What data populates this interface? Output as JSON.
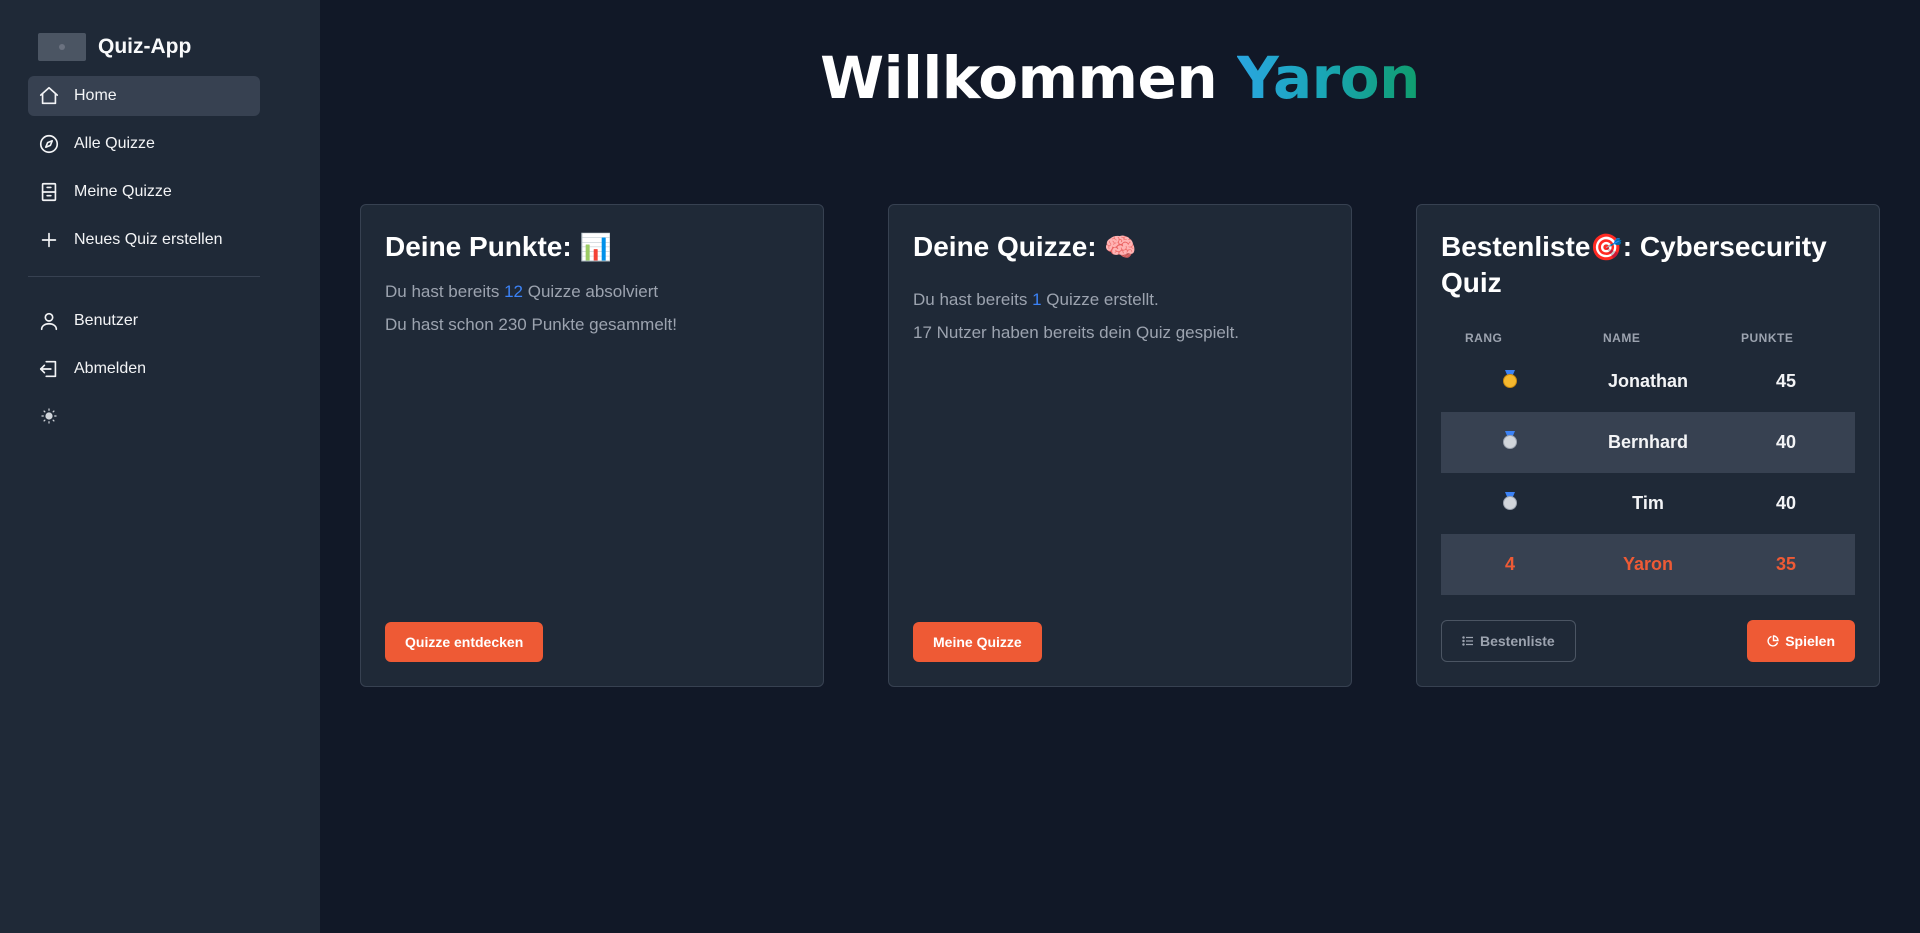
{
  "app": {
    "name": "Quiz-App"
  },
  "sidebar": {
    "items": [
      {
        "label": "Home",
        "icon": "home-icon",
        "active": true
      },
      {
        "label": "Alle Quizze",
        "icon": "compass-icon"
      },
      {
        "label": "Meine Quizze",
        "icon": "archive-icon"
      },
      {
        "label": "Neues Quiz erstellen",
        "icon": "plus-icon"
      }
    ],
    "secondary": [
      {
        "label": "Benutzer",
        "icon": "user-icon"
      },
      {
        "label": "Abmelden",
        "icon": "logout-icon"
      }
    ],
    "theme_icon": "sun-icon"
  },
  "header": {
    "greeting": "Willkommen",
    "username": "Yaron"
  },
  "points_card": {
    "title": "Deine Punkte:",
    "emoji": "📊",
    "line1_pre": "Du hast bereits",
    "line1_count": "12",
    "line1_post": "Quizze absolviert",
    "line2": "Du hast schon 230 Punkte gesammelt!",
    "button": "Quizze entdecken"
  },
  "quizzes_card": {
    "title": "Deine Quizze:",
    "emoji": "🧠",
    "line1_pre": "Du hast bereits",
    "line1_count": "1",
    "line1_post": "Quizze erstellt.",
    "line2": "17 Nutzer haben bereits dein Quiz gespielt.",
    "button": "Meine Quizze"
  },
  "leaderboard": {
    "title_pre": "Bestenliste",
    "emoji": "🎯",
    "title_post": ": Cybersecurity Quiz",
    "columns": [
      "RANG",
      "NAME",
      "PUNKTE"
    ],
    "rows": [
      {
        "rank": "",
        "medal": "gold",
        "name": "Jonathan",
        "points": "45"
      },
      {
        "rank": "",
        "medal": "silver",
        "name": "Bernhard",
        "points": "40"
      },
      {
        "rank": "",
        "medal": "silver",
        "name": "Tim",
        "points": "40"
      },
      {
        "rank": "4",
        "medal": "",
        "name": "Yaron",
        "points": "35"
      }
    ],
    "btn_list": "Bestenliste",
    "btn_play": "Spielen"
  },
  "colors": {
    "accent": "#ee5a35",
    "highlight": "#3b82f6",
    "bg": "#111827",
    "panel": "#1f2937"
  }
}
